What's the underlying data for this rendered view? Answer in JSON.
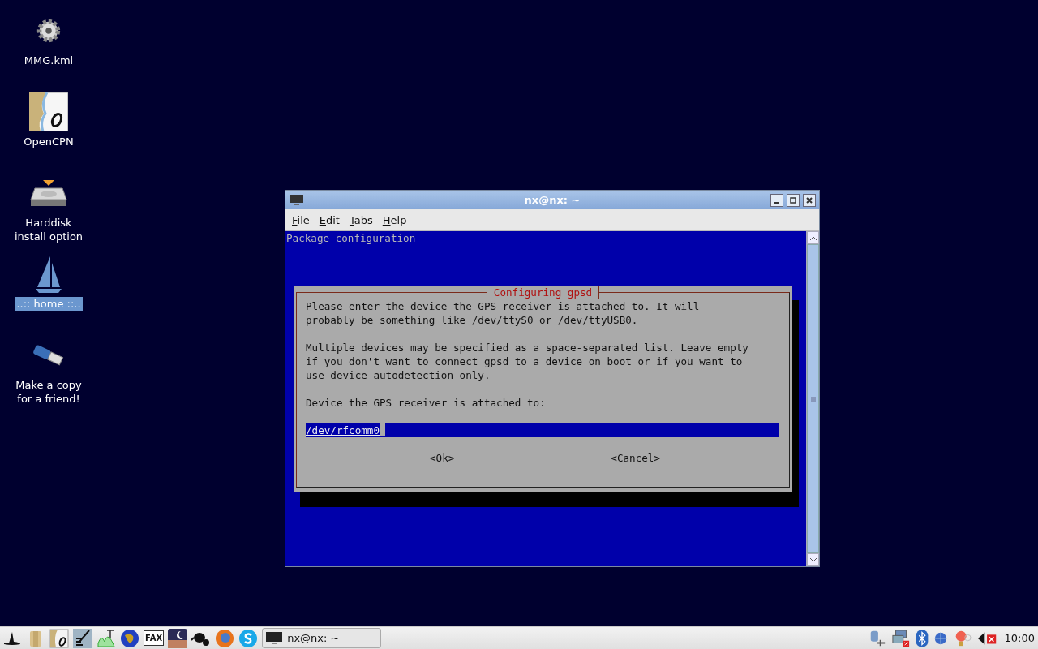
{
  "desktop_icons": [
    {
      "label": "MMG.kml",
      "kind": "gear",
      "selected": false
    },
    {
      "label": "OpenCPN",
      "kind": "chart",
      "selected": false
    },
    {
      "label": "Harddisk install option",
      "kind": "disk",
      "selected": false
    },
    {
      "label": "..:: home ::..",
      "kind": "sailboat",
      "selected": true
    },
    {
      "label": "Make a copy for a friend!",
      "kind": "usb",
      "selected": false
    }
  ],
  "window": {
    "title": "nx@nx: ~",
    "menu": [
      "File",
      "Edit",
      "Tabs",
      "Help"
    ],
    "terminal": {
      "header": "Package configuration",
      "dialog": {
        "title": "Configuring gpsd",
        "paragraphs": [
          [
            "Please enter the device the GPS receiver is attached to. It will",
            "probably be something like /dev/ttyS0 or /dev/ttyUSB0."
          ],
          [
            "Multiple devices may be specified as a space-separated list. Leave empty",
            "if you don't want to connect gpsd to a device on boot or if you want to",
            "use device autodetection only."
          ]
        ],
        "prompt": "Device the GPS receiver is attached to:",
        "input": {
          "value": "/dev/rfcomm0"
        },
        "buttons": [
          "<Ok>",
          "<Cancel>"
        ]
      }
    }
  },
  "taskbar": {
    "launchers": [
      {
        "kind": "hat"
      },
      {
        "kind": "folder"
      },
      {
        "kind": "chart"
      },
      {
        "kind": "pen"
      },
      {
        "kind": "graph"
      },
      {
        "kind": "globe"
      },
      {
        "kind": "fax",
        "label": "FAX"
      },
      {
        "kind": "moon"
      },
      {
        "kind": "bird"
      },
      {
        "kind": "browser"
      },
      {
        "kind": "chat"
      }
    ],
    "tasks": [
      {
        "label": "nx@nx: ~",
        "selected": false
      }
    ],
    "tray": [
      {
        "kind": "plug"
      },
      {
        "kind": "network"
      },
      {
        "kind": "bluetooth"
      },
      {
        "kind": "globe"
      },
      {
        "kind": "bulb"
      },
      {
        "kind": "speaker"
      }
    ],
    "clock": "10:00"
  }
}
